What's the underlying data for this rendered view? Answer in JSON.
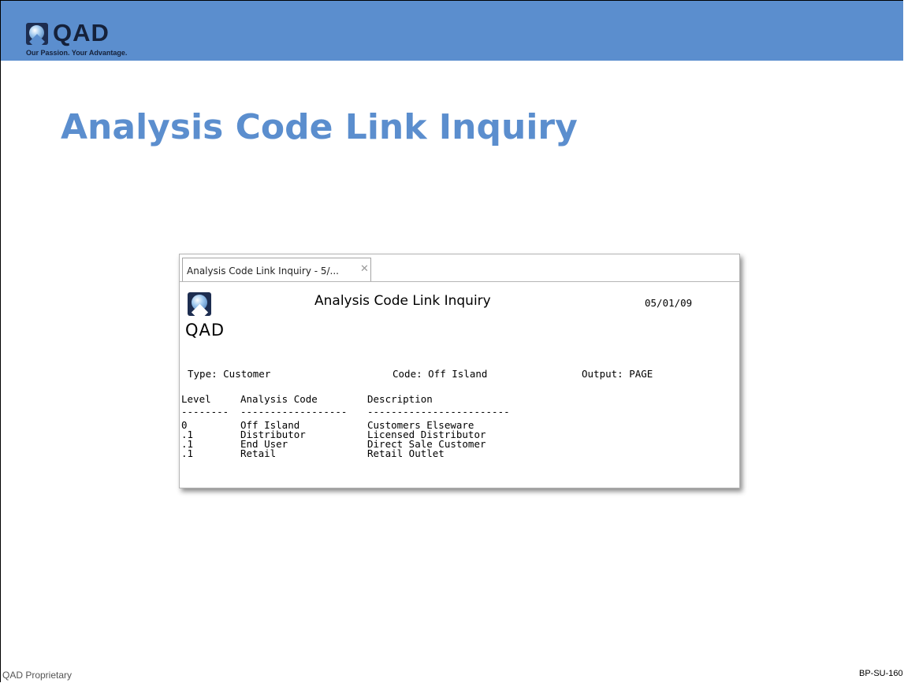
{
  "slide": {
    "title": "Analysis Code Link Inquiry",
    "logo": {
      "word": "QAD",
      "tagline": "Our Passion. Your Advantage."
    },
    "footer_left": "QAD Proprietary",
    "footer_right": "BP-SU-160",
    "colors": {
      "bar": "#5b8ece",
      "title": "#5b8ece"
    }
  },
  "window": {
    "tab_label": "Analysis Code Link Inquiry - 5/...",
    "close_icon": "close-icon"
  },
  "report": {
    "logo_word": "QAD",
    "title": "Analysis Code Link Inquiry",
    "date": "05/01/09",
    "type": "Type: Customer",
    "code": "Code: Off Island",
    "output": "Output: PAGE",
    "headers": [
      "Level",
      "Analysis Code",
      "Description"
    ],
    "dashes": [
      "--------",
      "------------------",
      "------------------------"
    ],
    "rows": [
      [
        "0",
        "Off Island",
        "Customers Elseware"
      ],
      [
        ".1",
        "Distributor",
        "Licensed Distributor"
      ],
      [
        ".1",
        "End User",
        "Direct Sale Customer"
      ],
      [
        ".1",
        "Retail",
        "Retail Outlet"
      ]
    ]
  }
}
